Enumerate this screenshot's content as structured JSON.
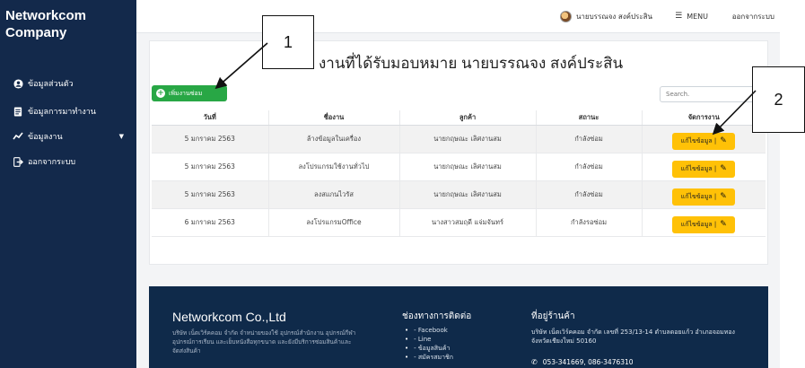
{
  "sidebar": {
    "brand": "Networkcom Company",
    "items": [
      {
        "label": "ข้อมูลส่วนตัว",
        "icon": "user-circle-icon"
      },
      {
        "label": "ข้อมูลการมาทำงาน",
        "icon": "id-card-icon"
      },
      {
        "label": "ข้อมูลงาน",
        "icon": "chart-line-icon",
        "has_caret": true
      },
      {
        "label": "ออกจากระบบ",
        "icon": "sign-out-icon"
      }
    ]
  },
  "topbar": {
    "user_name": "นายบรรณจง สงค์ประสิน",
    "menu_label": "MENU",
    "logout_label": "ออกจากระบบ"
  },
  "main": {
    "title": "งานที่ได้รับมอบหมาย นายบรรณจง สงค์ประสิน",
    "add_button": "เพิ่มงานซ่อม",
    "search_placeholder": "Search.",
    "columns": [
      "วันที่",
      "ชื่องาน",
      "ลูกค้า",
      "สถานะ",
      "จัดการงาน"
    ],
    "rows": [
      {
        "date": "5 มกราคม 2563",
        "task": "ล้างข้อมูลในเครื่อง",
        "customer": "นายกฤษณะ เลิศงานสม",
        "status": "กำลังซ่อม",
        "action": "แก้ไขข้อมูล |"
      },
      {
        "date": "5 มกราคม 2563",
        "task": "ลงโปรแกรมใช้งานทั่วไป",
        "customer": "นายกฤษณะ เลิศงานสม",
        "status": "กำลังซ่อม",
        "action": "แก้ไขข้อมูล |"
      },
      {
        "date": "5 มกราคม 2563",
        "task": "ลงสแกนไวรัส",
        "customer": "นายกฤษณะ เลิศงานสม",
        "status": "กำลังซ่อม",
        "action": "แก้ไขข้อมูล |"
      },
      {
        "date": "6 มกราคม 2563",
        "task": "ลงโปรแกรมOffice",
        "customer": "นางสาวสมฤดี แจ่มจันทร์",
        "status": "กำลังรอซ่อม",
        "action": "แก้ไขข้อมูล |"
      }
    ]
  },
  "footer": {
    "brand": "Networkcom Co.,Ltd",
    "description": "บริษัท เน็ตเวิร์คคอม จำกัด จำหน่ายของใช้ อุปกรณ์สำนักงาน อุปกรณ์กีฬา อุปกรณ์การเรียน และเย็บหนังสือทุกขนาด และยังมีบริการซ่อมสินค้าและจัดส่งสินค้า",
    "contact_heading": "ช่องทางการติดต่อ",
    "contact_links": [
      "- Facebook",
      "- Line",
      "- ข้อมูลสินค้า",
      "- สมัครสมาชิก"
    ],
    "address_heading": "ที่อยู่ร้านค้า",
    "address": "บริษัท เน็ตเวิร์คคอม จำกัด เลขที่ 253/13-14 ตำบลดอยแก้ว อำเภอจอมทอง จังหวัดเชียงใหม่ 50160",
    "phone": "053-341669, 086-3476310"
  },
  "annotations": {
    "callout_1": "1",
    "callout_2": "2"
  },
  "colors": {
    "sidebar_bg": "#13294b",
    "add_button": "#28a745",
    "edit_button": "#ffc107",
    "footer_bg": "#0f2a4a"
  }
}
